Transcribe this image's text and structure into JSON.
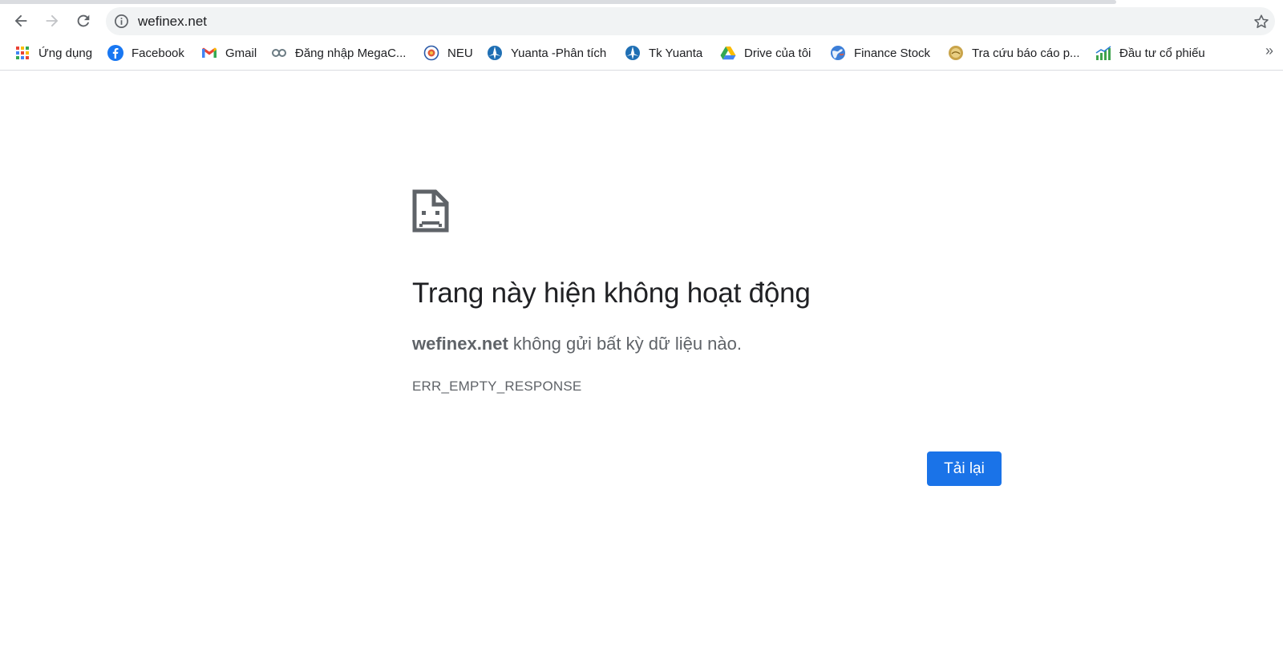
{
  "browser": {
    "url": "wefinex.net",
    "loading_progress": 0.87
  },
  "bookmarks": [
    {
      "label": "Ứng dụng",
      "icon": "apps-grid-icon"
    },
    {
      "label": "Facebook",
      "icon": "facebook-icon"
    },
    {
      "label": "Gmail",
      "icon": "gmail-icon"
    },
    {
      "label": "Đăng nhập MegaC...",
      "icon": "megac-icon"
    },
    {
      "label": "NEU",
      "icon": "neu-icon"
    },
    {
      "label": "Yuanta -Phân tích",
      "icon": "yuanta-icon"
    },
    {
      "label": "Tk Yuanta",
      "icon": "yuanta-icon"
    },
    {
      "label": "Drive của tôi",
      "icon": "google-drive-icon"
    },
    {
      "label": "Finance Stock",
      "icon": "globe-icon"
    },
    {
      "label": "Tra cứu báo cáo p...",
      "icon": "report-icon"
    },
    {
      "label": "Đầu tư cổ phiếu",
      "icon": "stock-chart-icon"
    }
  ],
  "more_bookmarks_label": "»",
  "error": {
    "title": "Trang này hiện không hoạt động",
    "host": "wefinex.net",
    "message": " không gửi bất kỳ dữ liệu nào.",
    "code": "ERR_EMPTY_RESPONSE",
    "reload_label": "Tải lại"
  },
  "colors": {
    "accent": "#1a73e8",
    "text_primary": "#202124",
    "text_secondary": "#5f6368",
    "omnibox_bg": "#f1f3f4"
  }
}
